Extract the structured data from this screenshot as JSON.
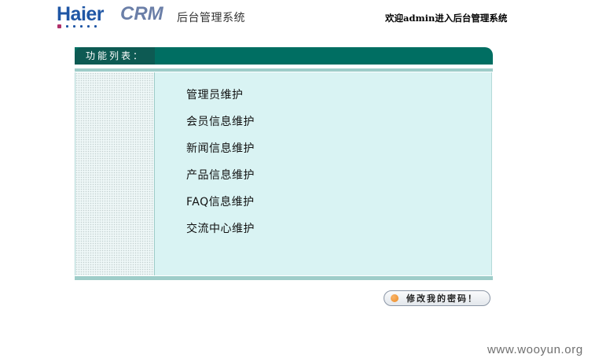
{
  "header": {
    "logo_brand": "Haier",
    "logo_product": "CRM",
    "system_title": "后台管理系统",
    "welcome_text": "欢迎admin进入后台管理系统"
  },
  "panel": {
    "header_label": "功能列表：",
    "menu_items": [
      "管理员维护",
      "会员信息维护",
      "新闻信息维护",
      "产品信息维护",
      "FAQ信息维护",
      "交流中心维护"
    ]
  },
  "actions": {
    "change_password_label": "修改我的密码！"
  },
  "watermark": "www.wooyun.org",
  "colors": {
    "panel_header": "#006e62",
    "panel_header_label": "#0d5a53",
    "panel_body": "#d9f3f3",
    "panel_bar": "#9ecdc9",
    "logo_blue": "#1f56a5",
    "button_dot": "#ec8a23"
  },
  "icons": {
    "button_dot": "orange-dot-icon"
  }
}
